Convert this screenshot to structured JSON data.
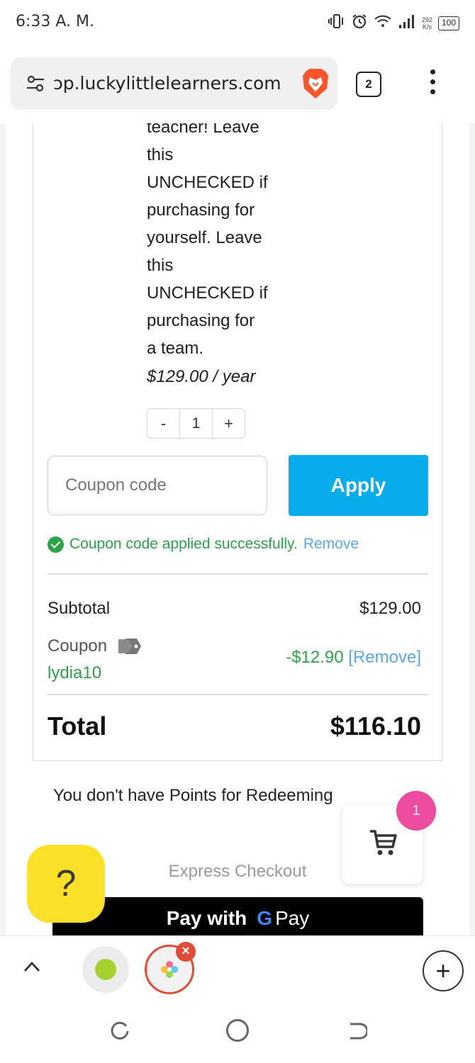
{
  "status_bar": {
    "time": "6:33 A. M.",
    "net_speed_value": "292",
    "net_speed_unit": "K/s",
    "battery": "100"
  },
  "browser": {
    "url": "ɔp.luckylittlelearners.com",
    "tab_count": "2"
  },
  "product": {
    "description_lines": [
      "teacher! Leave",
      "this",
      "UNCHECKED if",
      "purchasing for",
      "yourself. Leave",
      "this",
      "UNCHECKED if",
      "purchasing for",
      "a team."
    ],
    "price": "$129.00 / year",
    "quantity": {
      "minus": "-",
      "value": "1",
      "plus": "+"
    }
  },
  "coupon_form": {
    "placeholder": "Coupon code",
    "apply_label": "Apply",
    "success_message": "Coupon code applied successfully.",
    "remove_label": "Remove"
  },
  "totals": {
    "subtotal_label": "Subtotal",
    "subtotal_value": "$129.00",
    "coupon_label": "Coupon",
    "coupon_code": "lydia10",
    "coupon_discount": "-$12.90",
    "coupon_remove_label": "[Remove]",
    "total_label": "Total",
    "total_value": "$116.10"
  },
  "points_message": "You don't have Points for Redeeming",
  "express_checkout": {
    "label": "Express Checkout",
    "gpay_prefix": "Pay with",
    "gpay_g": "G",
    "gpay_suffix": "Pay"
  },
  "cart_widget": {
    "badge_count": "1"
  },
  "help_button": {
    "label": "?"
  },
  "colors": {
    "apply_button": "#07adea",
    "success_green": "#2ba34a",
    "link_blue": "#5aa9e6",
    "cart_badge": "#ed4b9e",
    "help_yellow": "#fbe02a"
  },
  "icons": {
    "tune": "tune-icon",
    "brave": "brave-lion-icon",
    "cart": "shopping-cart-icon",
    "tag": "price-tag-icon",
    "check": "check-circle-icon"
  }
}
